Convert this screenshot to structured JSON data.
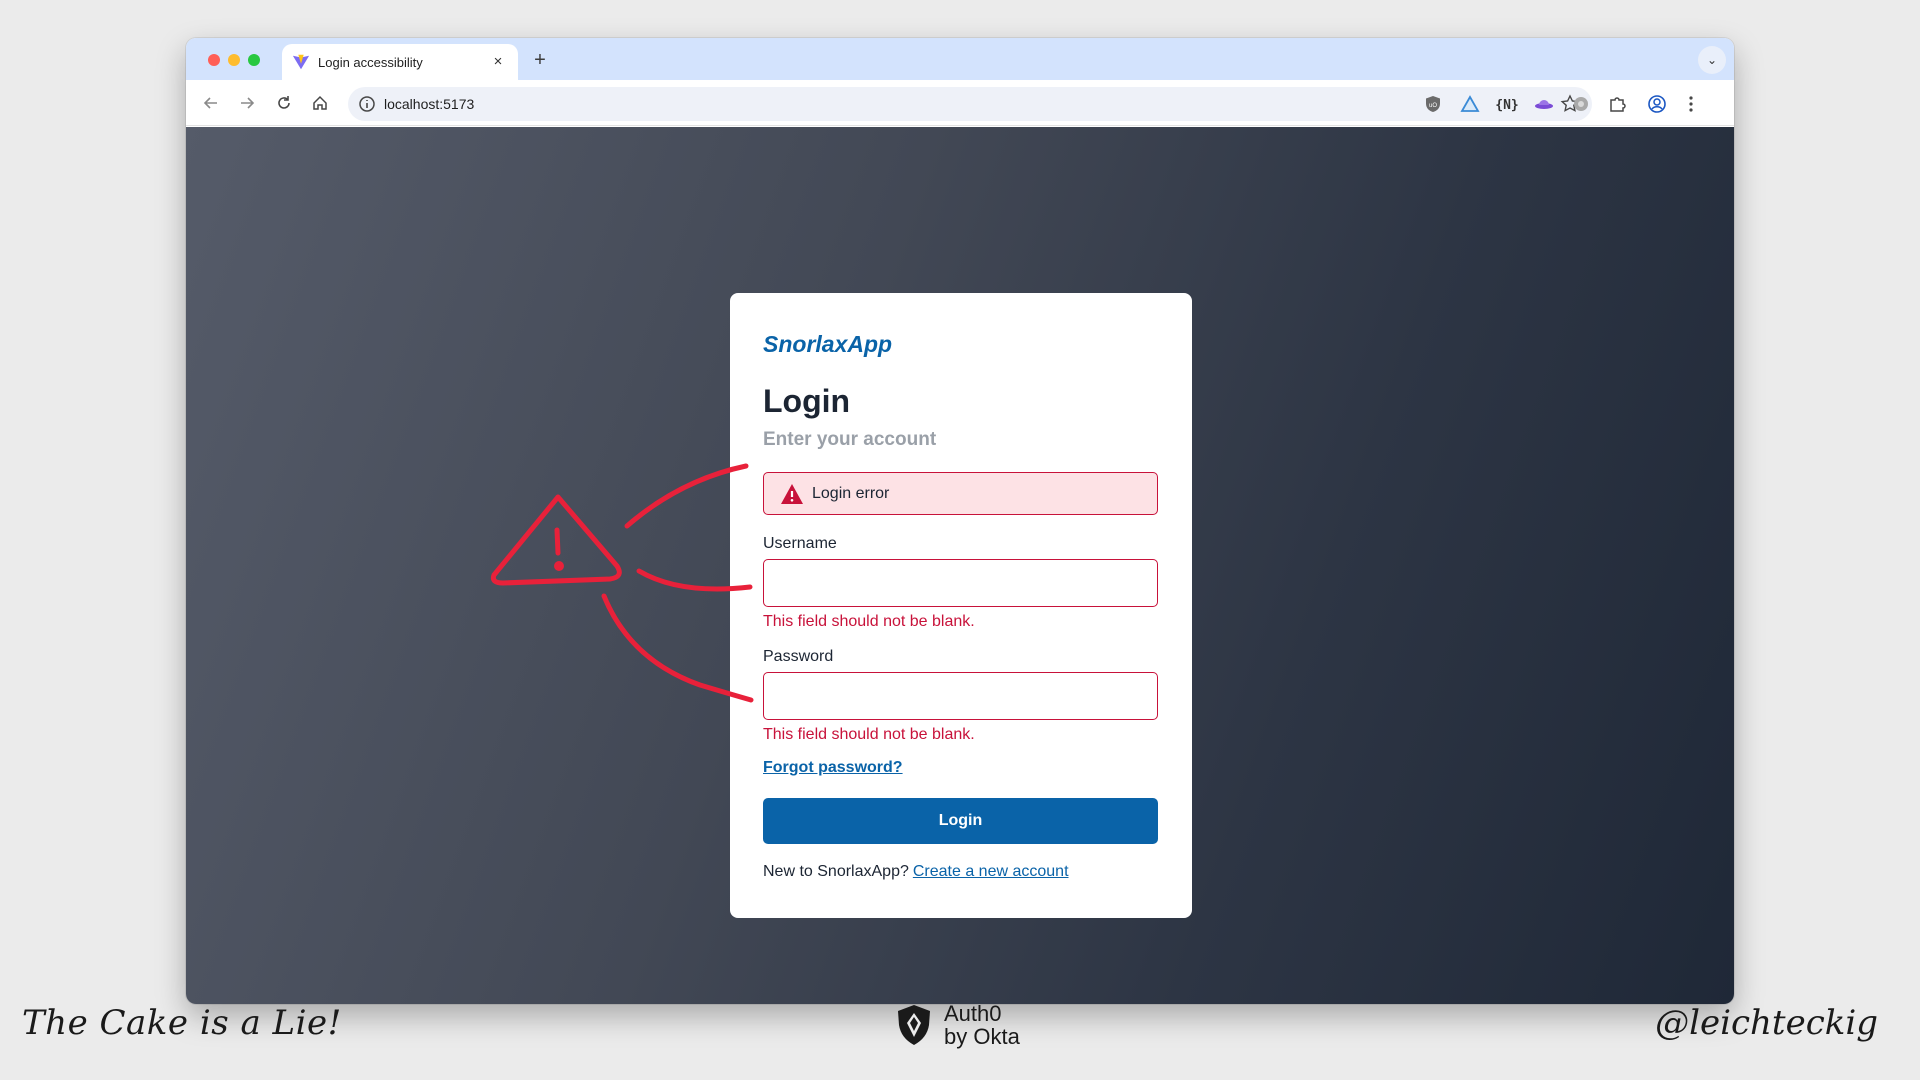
{
  "browser": {
    "tab_title": "Login accessibility",
    "tab_close": "×",
    "new_tab": "+",
    "tab_menu": "⌄",
    "url": "localhost:5173"
  },
  "card": {
    "brand": "SnorlaxApp",
    "title": "Login",
    "subtitle": "Enter your account",
    "alert_text": "Login error",
    "username_label": "Username",
    "username_value": "",
    "username_error": "This field should not be blank.",
    "password_label": "Password",
    "password_value": "",
    "password_error": "This field should not be blank.",
    "forgot_link": "Forgot password?",
    "login_button": "Login",
    "signup_prompt": "New to SnorlaxApp?",
    "signup_link": "Create a new account"
  },
  "slide": {
    "footer_left": "The Cake is a Lie!",
    "footer_right": "@leichteckig",
    "logo_line1": "Auth0",
    "logo_line2": "by Okta"
  },
  "colors": {
    "brand_blue": "#0a63a8",
    "error_red": "#c8123a",
    "alert_bg": "#fde2e5",
    "annotation_red": "#e8213a"
  }
}
